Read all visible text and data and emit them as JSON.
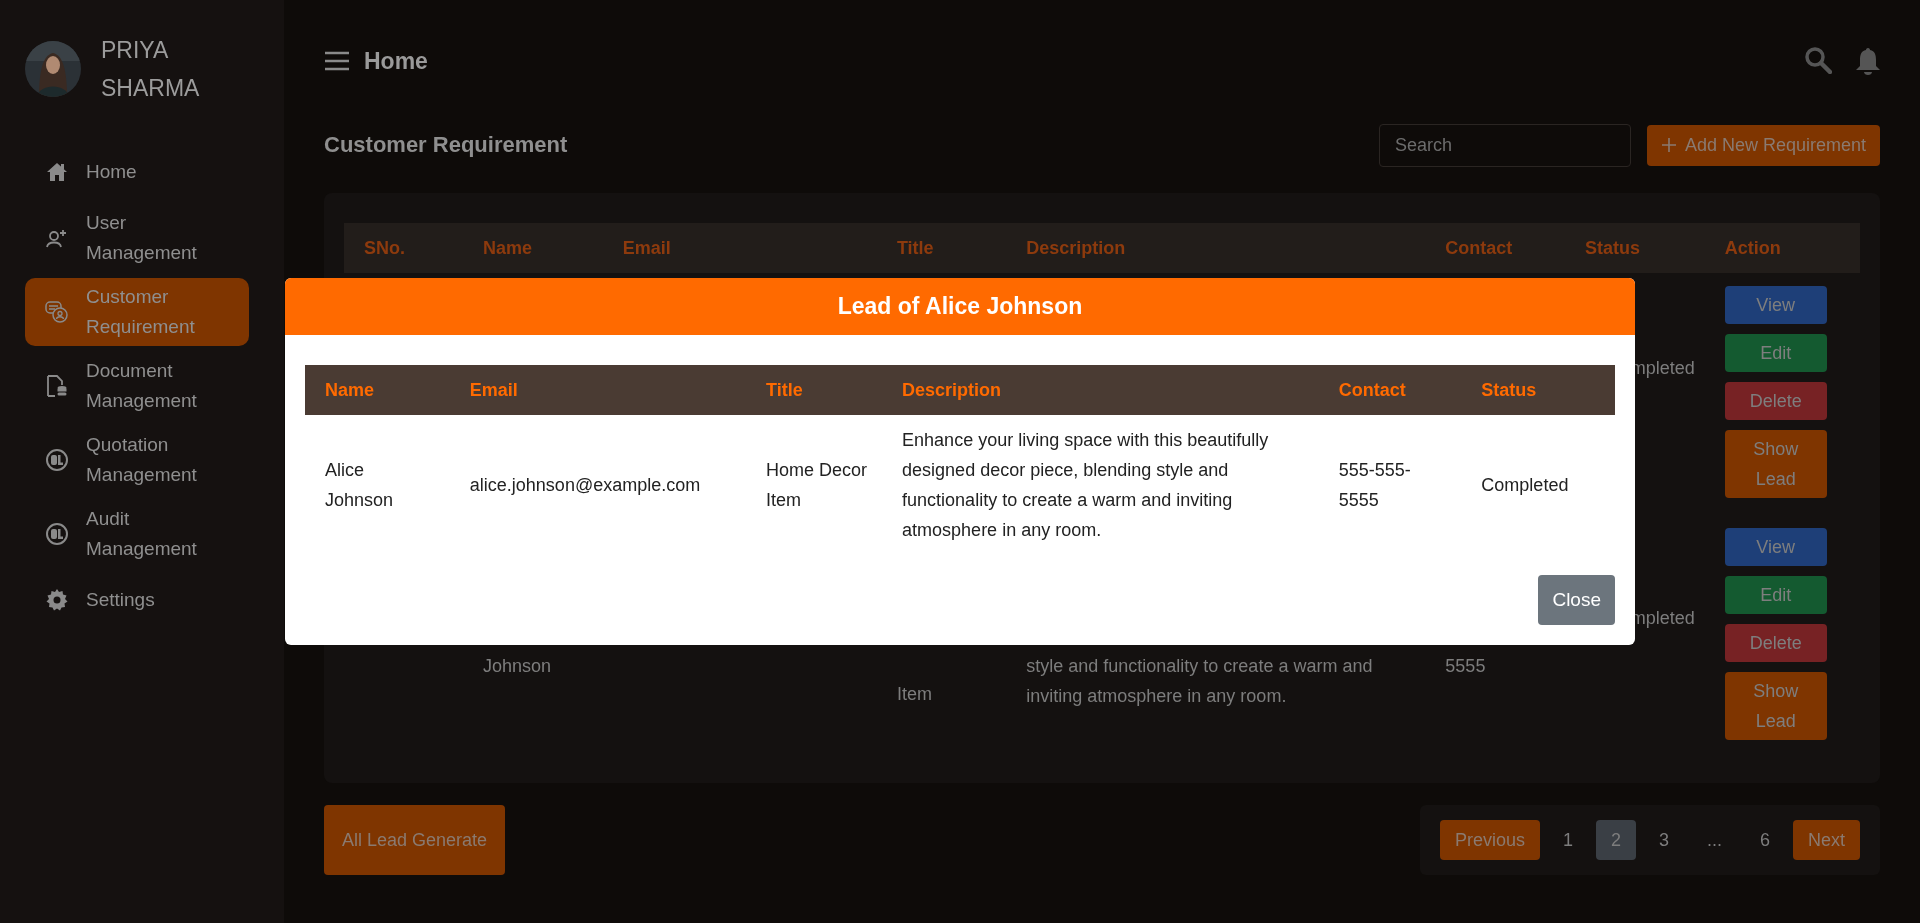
{
  "user": {
    "name": "PRIYA SHARMA"
  },
  "sidebar": {
    "items": [
      {
        "label": "Home",
        "selected": false
      },
      {
        "label": "User Management",
        "selected": false
      },
      {
        "label": "Customer Requirement",
        "selected": true
      },
      {
        "label": "Document Management",
        "selected": false
      },
      {
        "label": "Quotation Management",
        "selected": false
      },
      {
        "label": "Audit Management",
        "selected": false
      },
      {
        "label": "Settings",
        "selected": false
      }
    ]
  },
  "header": {
    "title": "Home"
  },
  "page": {
    "title": "Customer Requirement",
    "search": {
      "placeholder": "Search"
    },
    "add_button": "Add New Requirement"
  },
  "table": {
    "columns": [
      "SNo.",
      "Name",
      "Email",
      "Title",
      "Description",
      "Contact",
      "Status",
      "Action"
    ],
    "rows": [
      {
        "status": "mpleted",
        "actions": [
          "View",
          "Edit",
          "Delete",
          "Show Lead"
        ]
      },
      {
        "name": "Johnson",
        "title": "Item",
        "description_lines": [
          "style and functionality to create a warm and",
          "inviting atmosphere in any room."
        ],
        "contact": "5555",
        "status": "mpleted",
        "actions": [
          "View",
          "Edit",
          "Delete",
          "Show Lead"
        ]
      }
    ]
  },
  "footer": {
    "generate_button": "All Lead Generate",
    "pagination": {
      "previous": "Previous",
      "pages": [
        {
          "label": "1",
          "selected": false
        },
        {
          "label": "2",
          "selected": true
        },
        {
          "label": "3",
          "selected": false
        },
        {
          "label": "...",
          "selected": false
        },
        {
          "label": "6",
          "selected": false
        }
      ],
      "next": "Next"
    }
  },
  "modal": {
    "title": "Lead of Alice Johnson",
    "columns": [
      "Name",
      "Email",
      "Title",
      "Description",
      "Contact",
      "Status"
    ],
    "rows": [
      {
        "cells": [
          "Alice Johnson",
          "alice.johnson@example.com",
          "Home Decor Item",
          "Enhance your living space with this beautifully designed decor piece, blending style and functionality to create a warm and inviting atmosphere in any room.",
          "555-555-5555",
          "Completed"
        ]
      }
    ],
    "close_button": "Close"
  }
}
